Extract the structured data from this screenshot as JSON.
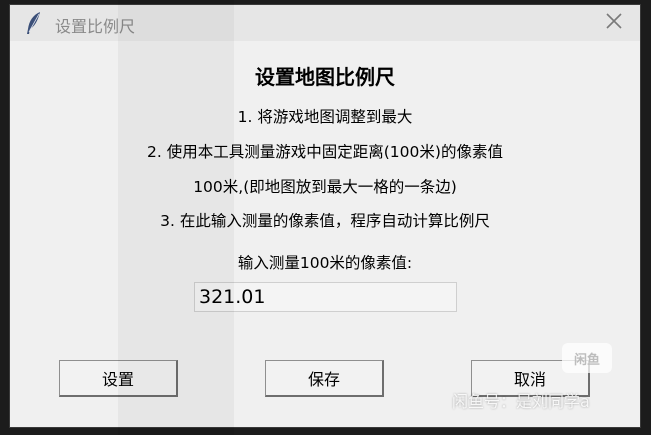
{
  "window": {
    "title": "设置比例尺",
    "close_symbol": "✕",
    "icon": "feather-icon"
  },
  "dialog": {
    "heading": "设置地图比例尺",
    "instructions": [
      "1. 将游戏地图调整到最大",
      "2. 使用本工具测量游戏中固定距离(100米)的像素值",
      "100米,(即地图放到最大一格的一条边)",
      "3. 在此输入测量的像素值，程序自动计算比例尺"
    ],
    "input_label": "输入测量100米的像素值:",
    "input_value": "321.01"
  },
  "buttons": {
    "set": "设置",
    "save": "保存",
    "cancel": "取消"
  },
  "watermark": {
    "badge": "闲鱼",
    "text": "闲鱼号：是刘同学a"
  }
}
